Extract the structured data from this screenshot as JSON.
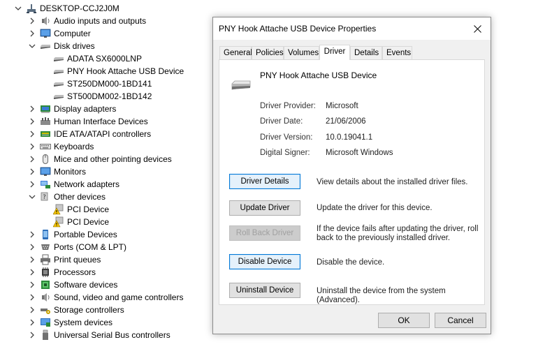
{
  "tree": {
    "root": "DESKTOP-CCJ2J0M",
    "items": [
      {
        "label": "Audio inputs and outputs",
        "icon": "speaker-icon",
        "state": "collapsed"
      },
      {
        "label": "Computer",
        "icon": "monitor-icon",
        "state": "collapsed"
      },
      {
        "label": "Disk drives",
        "icon": "disk-drive-icon",
        "state": "expanded"
      },
      {
        "label": "ADATA SX6000LNP",
        "icon": "disk-drive-icon",
        "state": "child"
      },
      {
        "label": "PNY Hook Attache USB Device",
        "icon": "disk-drive-icon",
        "state": "child"
      },
      {
        "label": "ST250DM000-1BD141",
        "icon": "disk-drive-icon",
        "state": "child"
      },
      {
        "label": "ST500DM002-1BD142",
        "icon": "disk-drive-icon",
        "state": "child"
      },
      {
        "label": "Display adapters",
        "icon": "display-adapter-icon",
        "state": "collapsed"
      },
      {
        "label": "Human Interface Devices",
        "icon": "hid-icon",
        "state": "collapsed"
      },
      {
        "label": "IDE ATA/ATAPI controllers",
        "icon": "ide-controller-icon",
        "state": "collapsed"
      },
      {
        "label": "Keyboards",
        "icon": "keyboard-icon",
        "state": "collapsed"
      },
      {
        "label": "Mice and other pointing devices",
        "icon": "mouse-icon",
        "state": "collapsed"
      },
      {
        "label": "Monitors",
        "icon": "monitor-icon",
        "state": "collapsed"
      },
      {
        "label": "Network adapters",
        "icon": "network-adapter-icon",
        "state": "collapsed"
      },
      {
        "label": "Other devices",
        "icon": "unknown-device-icon",
        "state": "expanded"
      },
      {
        "label": "PCI Device",
        "icon": "warning-device-icon",
        "state": "child"
      },
      {
        "label": "PCI Device",
        "icon": "warning-device-icon",
        "state": "child"
      },
      {
        "label": "Portable Devices",
        "icon": "portable-device-icon",
        "state": "collapsed"
      },
      {
        "label": "Ports (COM & LPT)",
        "icon": "port-icon",
        "state": "collapsed"
      },
      {
        "label": "Print queues",
        "icon": "printer-icon",
        "state": "collapsed"
      },
      {
        "label": "Processors",
        "icon": "processor-icon",
        "state": "collapsed"
      },
      {
        "label": "Software devices",
        "icon": "software-device-icon",
        "state": "collapsed"
      },
      {
        "label": "Sound, video and game controllers",
        "icon": "speaker-icon",
        "state": "collapsed"
      },
      {
        "label": "Storage controllers",
        "icon": "storage-controller-icon",
        "state": "collapsed"
      },
      {
        "label": "System devices",
        "icon": "system-device-icon",
        "state": "collapsed"
      },
      {
        "label": "Universal Serial Bus controllers",
        "icon": "usb-icon",
        "state": "collapsed"
      }
    ]
  },
  "dialog": {
    "title": "PNY Hook Attache USB Device Properties",
    "tabs": [
      "General",
      "Policies",
      "Volumes",
      "Driver",
      "Details",
      "Events"
    ],
    "active_tab": "Driver",
    "device_name": "PNY Hook Attache USB Device",
    "properties": [
      {
        "label": "Driver Provider:",
        "value": "Microsoft"
      },
      {
        "label": "Driver Date:",
        "value": "21/06/2006"
      },
      {
        "label": "Driver Version:",
        "value": "10.0.19041.1"
      },
      {
        "label": "Digital Signer:",
        "value": "Microsoft Windows"
      }
    ],
    "actions": [
      {
        "label": "Driver Details",
        "description": "View details about the installed driver files.",
        "state": "focused"
      },
      {
        "label": "Update Driver",
        "description": "Update the driver for this device.",
        "state": "normal"
      },
      {
        "label": "Roll Back Driver",
        "description": "If the device fails after updating the driver, roll back to the previously installed driver.",
        "state": "disabled"
      },
      {
        "label": "Disable Device",
        "description": "Disable the device.",
        "state": "focused"
      },
      {
        "label": "Uninstall Device",
        "description": "Uninstall the device from the system (Advanced).",
        "state": "normal"
      }
    ],
    "ok_label": "OK",
    "cancel_label": "Cancel"
  },
  "colors": {
    "accent": "#0078d7",
    "dialog_bg": "#f0f0f0",
    "warning": "#f5c400"
  }
}
